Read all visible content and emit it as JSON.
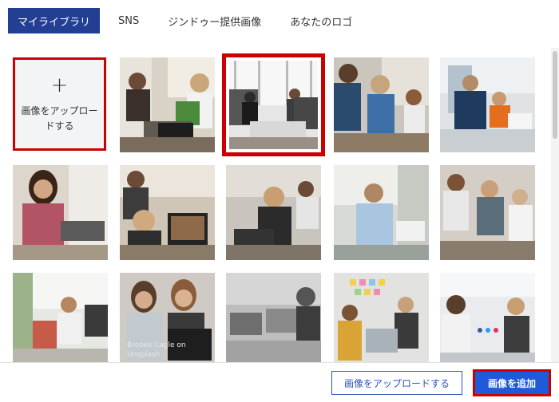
{
  "tabs": [
    {
      "label": "マイライブラリ"
    },
    {
      "label": "SNS"
    },
    {
      "label": "ジンドゥー提供画像"
    },
    {
      "label": "あなたのロゴ"
    }
  ],
  "upload_tile": {
    "plus": "+",
    "label": "画像をアップロードする"
  },
  "photo_credit": "Brooke Cagle on Unsplash",
  "footer": {
    "upload_button": "画像をアップロードする",
    "add_button": "画像を追加"
  },
  "colors": {
    "accent": "#223f94",
    "primary_button": "#1f5adb",
    "highlight": "#cc0000"
  }
}
